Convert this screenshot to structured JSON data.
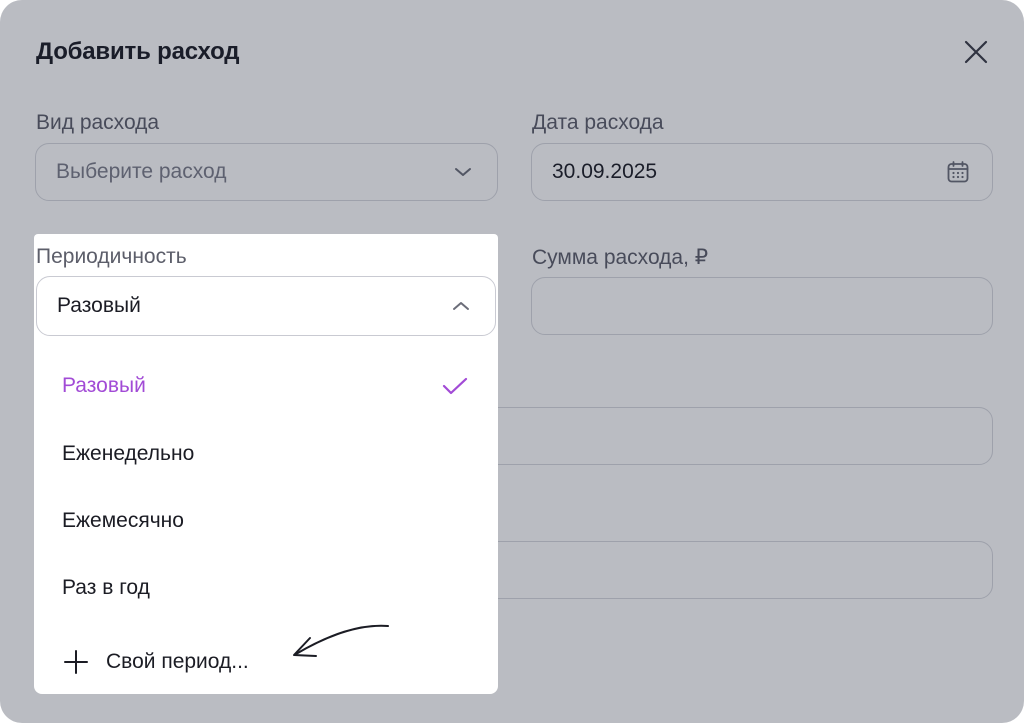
{
  "modal": {
    "title": "Добавить расход",
    "close_icon": "close-icon"
  },
  "fields": {
    "expense_type": {
      "label": "Вид расхода",
      "placeholder": "Выберите расход",
      "icon": "chevron-down-icon"
    },
    "expense_date": {
      "label": "Дата расхода",
      "value": "30.09.2025",
      "icon": "calendar-icon"
    },
    "periodicity": {
      "label": "Периодичность",
      "value": "Разовый",
      "icon": "chevron-up-icon"
    },
    "amount": {
      "label": "Сумма расхода, ₽",
      "value": ""
    }
  },
  "dropdown": {
    "options": [
      {
        "label": "Разовый",
        "selected": true
      },
      {
        "label": "Еженедельно",
        "selected": false
      },
      {
        "label": "Ежемесячно",
        "selected": false
      },
      {
        "label": "Раз в год",
        "selected": false
      }
    ],
    "custom_label": "Свой период...",
    "custom_icon": "plus-icon",
    "check_icon": "check-icon"
  },
  "colors": {
    "accent": "#a24bd6",
    "text": "#1b1c24",
    "muted": "#5c5e6a",
    "border": "#d7d8de",
    "overlay": "rgba(28, 32, 52, 0.30)"
  }
}
